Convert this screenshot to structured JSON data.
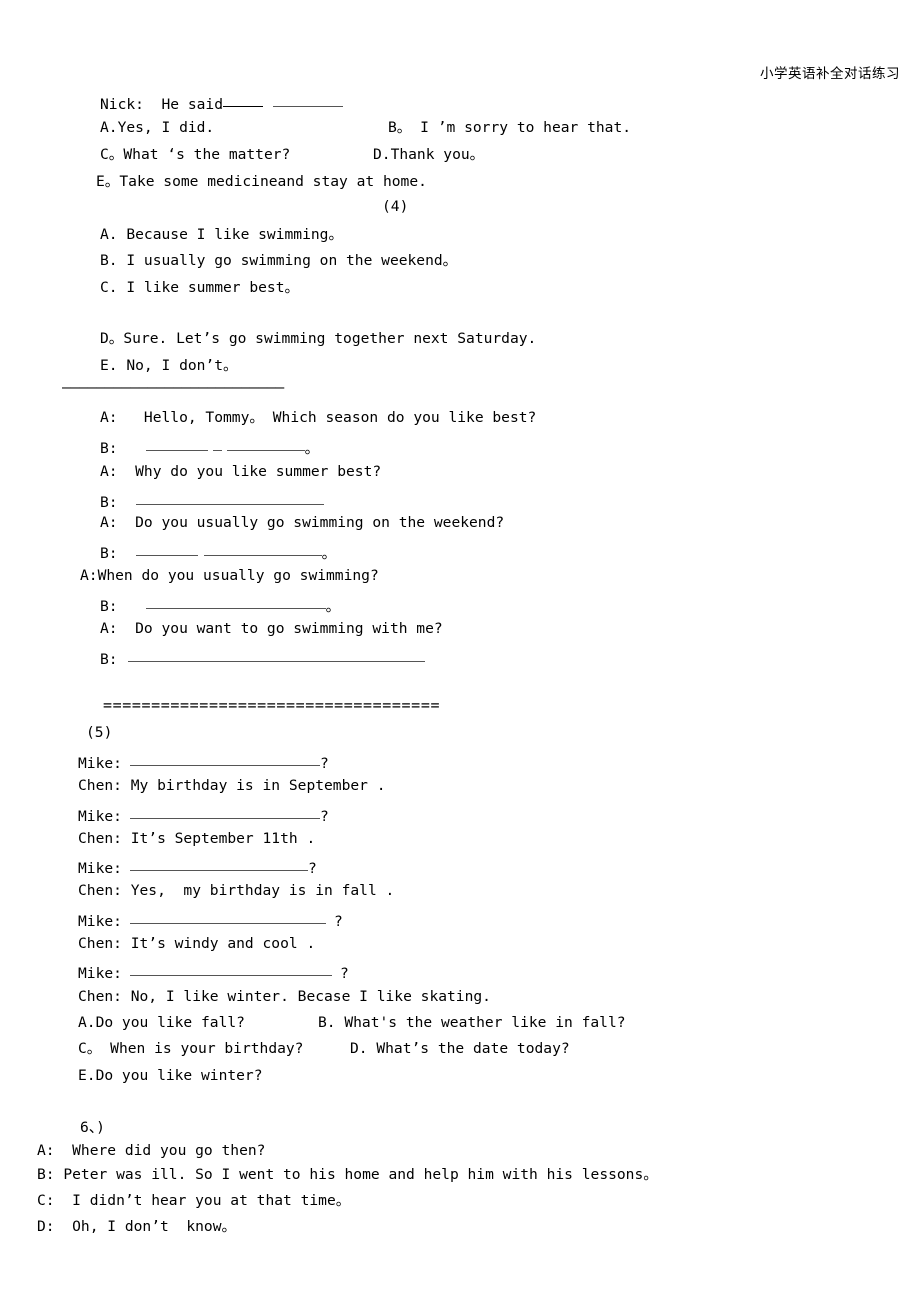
{
  "header": {
    "title": "小学英语补全对话练习"
  },
  "section_nick": {
    "prompt": "Nick:  He said",
    "options": {
      "a": "A.Yes, I did.",
      "b": "B。 I ’m sorry to hear that.",
      "c": "C。What ‘s the matter?",
      "d": "D.Thank you。",
      "e": "E。Take some medicineand stay at home."
    }
  },
  "section_4": {
    "number": "(4)",
    "options": {
      "a": "A. Because I like swimming。",
      "b": "B. I usually go swimming on the weekend。",
      "c": "C. I like summer best。",
      "d": "D。Sure. Let’s go swimming together next Saturday.",
      "e": "E. No, I don’t。"
    },
    "separator_dash": "——————————————————————————",
    "dialogue": {
      "l1": "A:   Hello, Tommy。 Which season do you like best?",
      "l2_speaker": "B:",
      "l2_tail": "。",
      "l3": "A:  Why do you like summer best?",
      "l4_speaker": "B:",
      "l5": "A:  Do you usually go swimming on the weekend?",
      "l6_speaker": "B:",
      "l6_tail": "。",
      "l7": "A:When do you usually go swimming?",
      "l8_speaker": "B:",
      "l8_tail": "。",
      "l9": "A:  Do you want to go swimming with me?",
      "l10_speaker": "B:"
    }
  },
  "section_5": {
    "separator_equals": "===================================",
    "number": "(5)",
    "dialogue": {
      "l1_speaker": "Mike:",
      "l1_tail": "?",
      "l2": "Chen: My birthday is in September .",
      "l3_speaker": "Mike:",
      "l3_tail": "?",
      "l4": "Chen: It’s September 11th .",
      "l5_speaker": "Mike:",
      "l5_tail": "?",
      "l6": "Chen: Yes,  my birthday is in fall .",
      "l7_speaker": "Mike:",
      "l7_tail": "?",
      "l8": "Chen: It’s windy and cool .",
      "l9_speaker": "Mike:",
      "l9_tail": "?",
      "l10": "Chen: No, I like winter. Becase I like skating."
    },
    "options": {
      "a": "A.Do you like fall?",
      "b": "B. What's the weather like in fall?",
      "c": "C。 When is your birthday?",
      "d": "D. What’s the date today?",
      "e": "E.Do you like winter?"
    }
  },
  "section_6": {
    "number": "6、)",
    "lines": {
      "a": "A:  Where did you go then?",
      "b": "B: Peter was ill. So I went to his home and help him with his lessons。",
      "c": "C:  I didn’t hear you at that time。",
      "d": "D:  Oh, I don’t  know。"
    }
  }
}
